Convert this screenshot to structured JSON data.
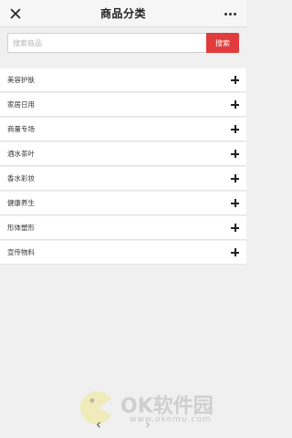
{
  "header": {
    "title": "商品分类",
    "close_icon": "close-icon",
    "more_icon": "more-dots-icon"
  },
  "search": {
    "placeholder": "搜索商品",
    "value": "",
    "button_label": "搜索"
  },
  "categories": [
    {
      "label": "美容护肤",
      "icon": "plus-icon"
    },
    {
      "label": "家居日用",
      "icon": "plus-icon"
    },
    {
      "label": "商量专场",
      "icon": "plus-icon"
    },
    {
      "label": "酒水茶叶",
      "icon": "plus-icon"
    },
    {
      "label": "香水彩妆",
      "icon": "plus-icon"
    },
    {
      "label": "健康养生",
      "icon": "plus-icon"
    },
    {
      "label": "形体塑形",
      "icon": "plus-icon"
    },
    {
      "label": "宣传物料",
      "icon": "plus-icon"
    }
  ],
  "bottom_nav": {
    "back": "‹",
    "forward": "›"
  },
  "watermark": {
    "brand": "OK软件园",
    "url": "www.okemu.com"
  },
  "colors": {
    "accent": "#e23b3b",
    "background": "#f0f0f0"
  }
}
